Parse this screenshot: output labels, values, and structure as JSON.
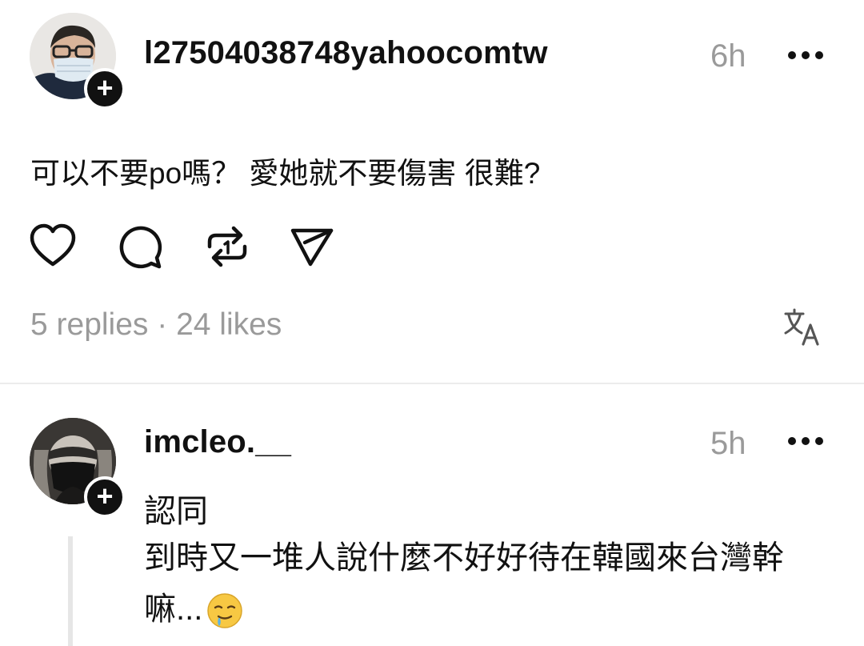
{
  "post": {
    "username": "l27504038748yahoocomtw",
    "time": "6h",
    "text": "可以不要po嗎？ 愛她就不要傷害 很難?",
    "stats": "5 replies · 24 likes",
    "follow_glyph": "+"
  },
  "reply": {
    "username": "imcleo.__",
    "time": "5h",
    "line1": "認同",
    "line2": "到時又一堆人說什麼不好好待在韓國來台灣幹",
    "line3": "嘛...",
    "follow_glyph": "+"
  },
  "icons": {
    "like": "heart-icon",
    "comment": "comment-bubble-icon",
    "repost": "repost-icon",
    "share": "send-icon",
    "translate": "translate-icon",
    "more": "more-dots-icon",
    "emoji": "drooling-face-emoji"
  },
  "colors": {
    "text": "#111111",
    "muted": "#9a9a9a",
    "divider": "#ececec",
    "thread_line": "#e6e6e6"
  }
}
